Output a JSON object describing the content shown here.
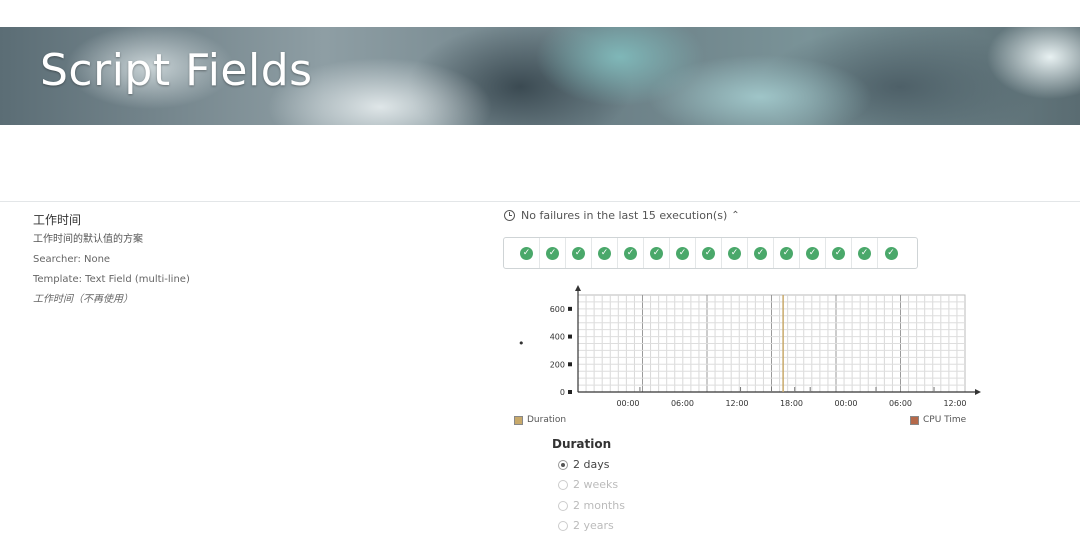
{
  "banner": {
    "title": "Script Fields"
  },
  "field": {
    "name": "工作时间",
    "description": "工作时间的默认值的方案",
    "searcher": "Searcher: None",
    "template": "Template: Text Field (multi-line)",
    "note": "工作时间（不再使用）"
  },
  "executions": {
    "summary": "No failures in the last 15 execution(s)",
    "count": 15,
    "status_icon": "check-circle-icon",
    "status_color": "#4aa86a"
  },
  "chart_data": {
    "type": "line",
    "x_tick_labels": [
      "00:00",
      "06:00",
      "12:00",
      "18:00",
      "00:00",
      "06:00",
      "12:00"
    ],
    "y_tick_labels": [
      "0",
      "200",
      "400",
      "600"
    ],
    "ylim": [
      0,
      700
    ],
    "grid": true,
    "series": [
      {
        "name": "Duration",
        "color": "#c8a96a"
      },
      {
        "name": "CPU Time",
        "color": "#b5694a"
      }
    ],
    "highlight_line_x_fraction": 0.53
  },
  "duration": {
    "title": "Duration",
    "options": [
      {
        "label": "2 days",
        "checked": true,
        "enabled": true
      },
      {
        "label": "2 weeks",
        "checked": false,
        "enabled": false
      },
      {
        "label": "2 months",
        "checked": false,
        "enabled": false
      },
      {
        "label": "2 years",
        "checked": false,
        "enabled": false
      }
    ]
  }
}
